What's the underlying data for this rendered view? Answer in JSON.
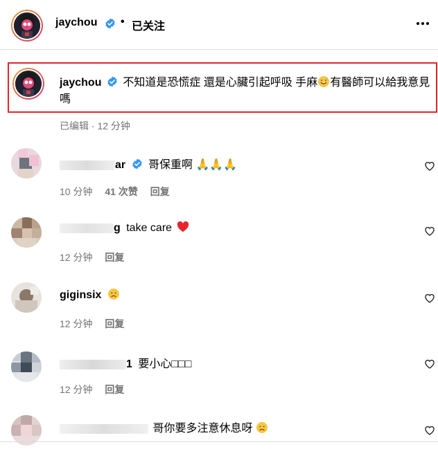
{
  "header": {
    "username": "jaychou",
    "dot": "•",
    "follow_status": "已关注"
  },
  "caption": {
    "username": "jaychou",
    "text_part1": "不知道是恐慌症 還是心臟引起呼吸 手麻",
    "text_part2": "有醫師可以給我意見嗎",
    "edited": "已编辑",
    "separator": "·",
    "time": "12 分钟"
  },
  "comments": [
    {
      "name_suffix": "ar",
      "text": "哥保重啊",
      "time": "10 分钟",
      "likes": "41 次赞",
      "reply": "回复",
      "verified": true
    },
    {
      "name_suffix": "g",
      "text": "take care",
      "time": "12 分钟",
      "reply": "回复"
    },
    {
      "name": "giginsix",
      "text": "",
      "time": "12 分钟",
      "reply": "回复"
    },
    {
      "name_suffix": "1",
      "text": "要小心□□□",
      "time": "12 分钟",
      "reply": "回复"
    },
    {
      "text": "哥你要多注意休息呀",
      "time": "",
      "reply": ""
    }
  ],
  "icons": {
    "more": "more-icon",
    "heart": "heart-outline-icon",
    "verified": "verified-badge-icon"
  },
  "colors": {
    "verified_blue": "#3897f0",
    "highlight_red": "#e0262b",
    "meta_gray": "#737373"
  }
}
